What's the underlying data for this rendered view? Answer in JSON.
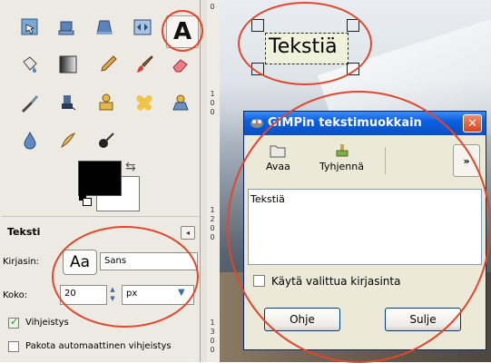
{
  "toolbox": {
    "tools_row1": [
      "rect-select-icon",
      "clone-stamp-icon",
      "perspective-icon",
      "flip-icon",
      "text-tool-icon"
    ],
    "tools_row2": [
      "bucket-fill-icon",
      "blend-icon",
      "pencil-icon",
      "paintbrush-icon",
      "eraser-icon"
    ],
    "tools_row3": [
      "airbrush-icon",
      "ink-icon",
      "clone-icon",
      "heal-icon",
      "perspective-clone-icon"
    ],
    "tools_row4": [
      "blur-icon",
      "smudge-icon",
      "dodge-icon"
    ],
    "text_tool_glyph": "A",
    "fg_color": "#000000",
    "bg_color": "#ffffff"
  },
  "options": {
    "title": "Teksti",
    "font_label": "Kirjasin:",
    "font_preview": "Aa",
    "font_value": "Sans",
    "size_label": "Koko:",
    "size_value": "20",
    "unit_value": "px",
    "hinting_label": "Vihjeistys",
    "hinting_checked": true,
    "force_hinting_label": "Pakota automaattinen vihjeistys",
    "force_hinting_checked": false
  },
  "ruler": {
    "labels_top": [
      "0"
    ],
    "labels_mid": [
      "1",
      "0",
      "0"
    ],
    "labels_low": [
      "1",
      "2",
      "0",
      "0"
    ],
    "labels_bottom": [
      "1",
      "3",
      "0",
      "0"
    ]
  },
  "canvas": {
    "text_layer": "Tekstiä"
  },
  "dialog": {
    "title": "GIMPin tekstimuokkain",
    "close_glyph": "✕",
    "open_label": "Avaa",
    "clear_label": "Tyhjennä",
    "more_glyph": "»",
    "editor_text": "Tekstiä",
    "use_selected_font_label": "Käytä valittua kirjasinta",
    "help_label": "Ohje",
    "close_label": "Sulje"
  },
  "colors": {
    "annotation_ring": "#e0472c",
    "titlebar_blue": "#0b5fe0"
  }
}
